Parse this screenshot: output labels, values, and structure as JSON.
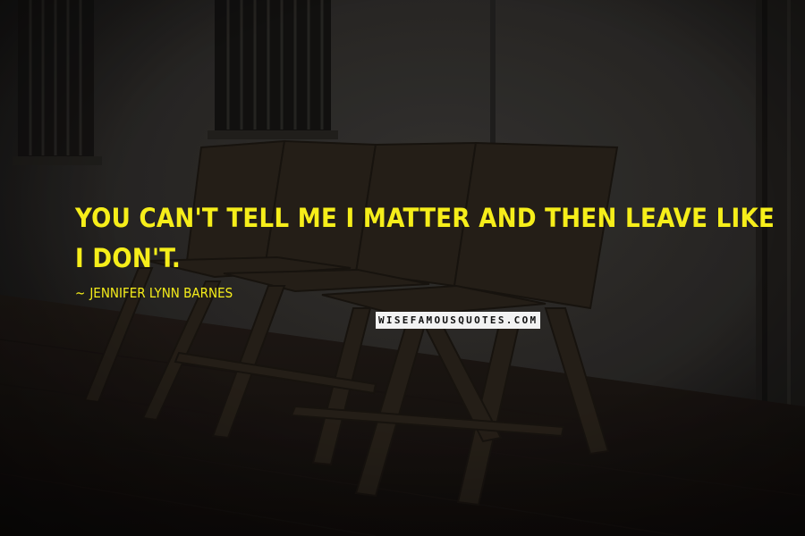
{
  "quote": {
    "text": "YOU CAN'T TELL ME I MATTER AND THEN LEAVE LIKE I DON'T.",
    "author_prefix": "~",
    "author": "JENNIFER LYNN BARNES"
  },
  "watermark": {
    "text": "WISEFAMOUSQUOTES.COM"
  },
  "colors": {
    "quote_text": "#f6ee1a",
    "background_dark": "#141313",
    "wall": "#2f2d2a",
    "bench_wood": "#2a231b"
  },
  "scene": {
    "description_icon": "bench-photo-icon"
  }
}
